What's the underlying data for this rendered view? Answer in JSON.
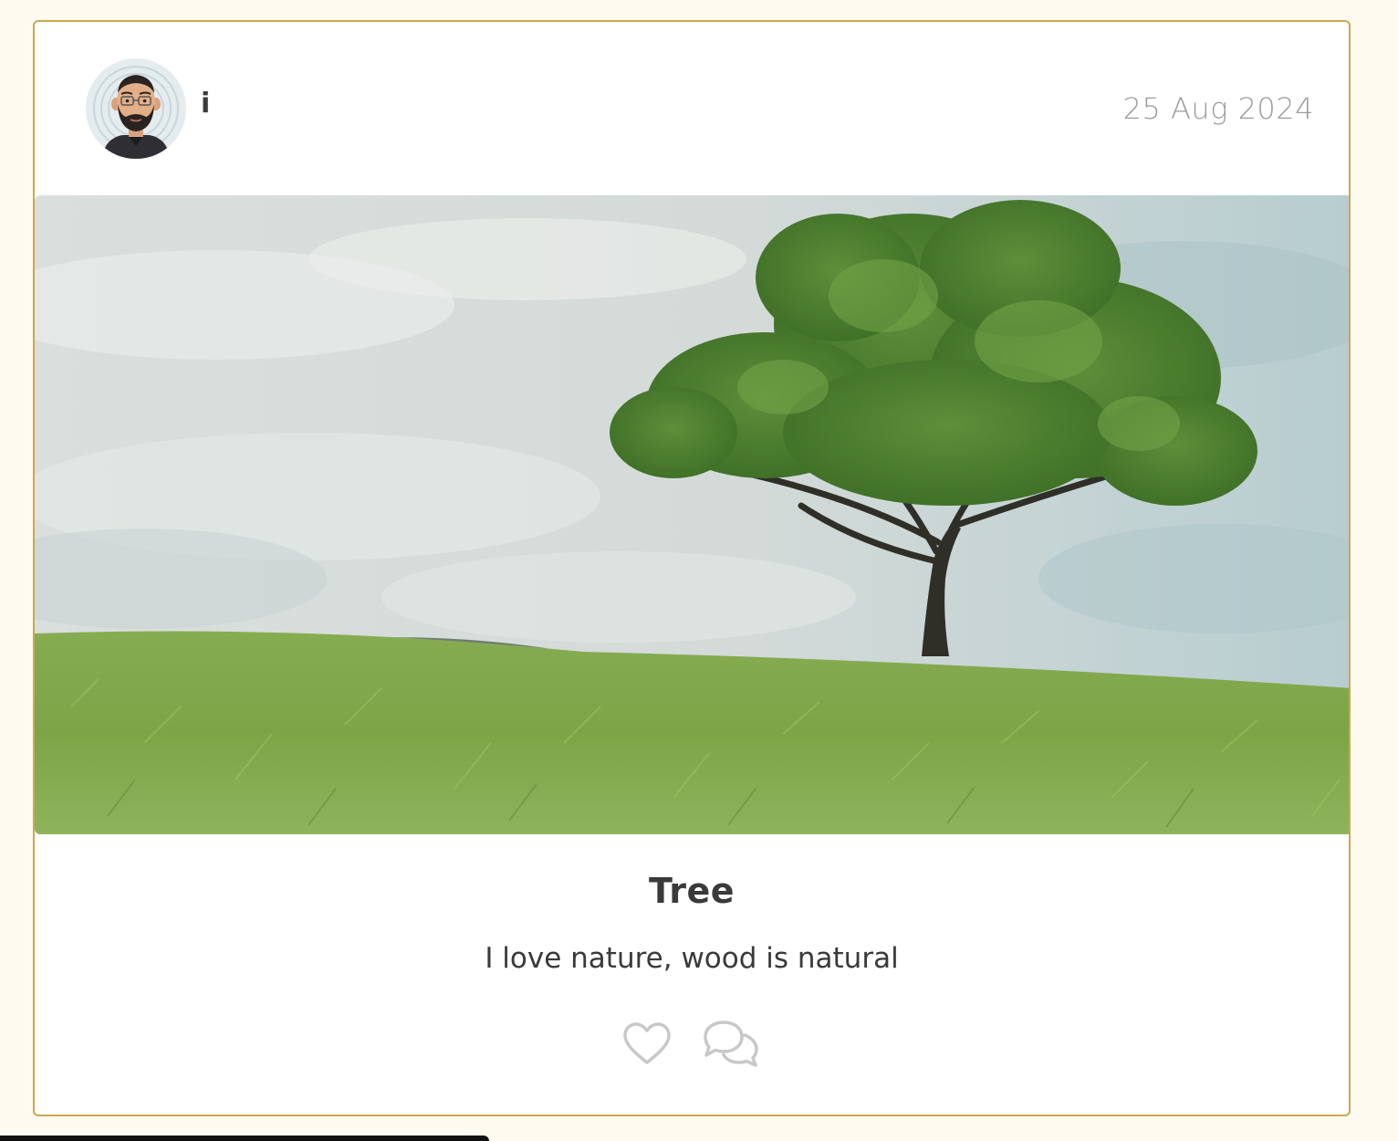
{
  "post": {
    "author": "i",
    "date": "25 Aug 2024",
    "title": "Tree",
    "description": "I love nature, wood is natural",
    "image_subject": "lone-tree-in-grass-field"
  },
  "icons": {
    "like": "heart-outline-icon",
    "comment": "speech-bubbles-icon"
  },
  "colors": {
    "page_background": "#fdfbef",
    "card_border": "#cfa650",
    "text_primary": "#3a3a3a",
    "text_muted": "#9c9c9c",
    "icon_muted": "#c8c8c8"
  }
}
